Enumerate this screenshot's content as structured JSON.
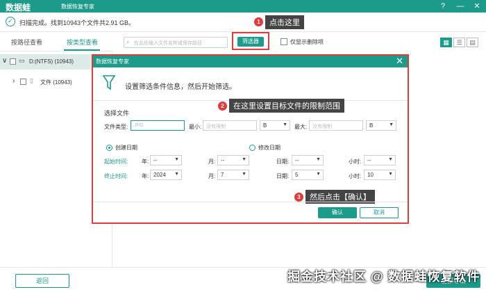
{
  "app": {
    "name": "数据蛙",
    "subtitle": "数据恢复专家",
    "controls": [
      "?",
      "—",
      "✕"
    ]
  },
  "status": {
    "text": "扫描完成。找到10943个文件共2.91 GB。"
  },
  "nav": {
    "tabs": [
      "按路径查看",
      "按类型查看"
    ],
    "active": 1
  },
  "toolbar": {
    "search_placeholder": "在此处输入文件名称或保存路径",
    "filter_label": "筛选器",
    "show_deleted_label": "仅显示删除项"
  },
  "tree": {
    "items": [
      {
        "label": "D:(NTFS) (10943)",
        "expand": "∨"
      },
      {
        "label": "文件 (10943)",
        "expand": "›"
      }
    ]
  },
  "dialog": {
    "title": "数据恢复专家",
    "close": "✕",
    "intro": "设置筛选条件信息，然后开始筛选。",
    "section": "选择文件",
    "file_type_label": "文件类型:",
    "file_type_placeholder": "JPG",
    "min_label": "最小:",
    "min_placeholder": "没有限制",
    "min_unit": "B",
    "max_label": "最大:",
    "max_placeholder": "没有限制",
    "max_unit": "B",
    "create_date_label": "创建日期",
    "modify_date_label": "修改日期",
    "start_label": "起始时间:",
    "end_label": "终止时间:",
    "year_label": "年:",
    "month_label": "月:",
    "day_label": "日期:",
    "hour_label": "小时:",
    "start": {
      "year": "--",
      "month": "--",
      "day": "--",
      "hour": "--"
    },
    "end": {
      "year": "2024",
      "month": "7",
      "day": "5",
      "hour": "10"
    },
    "confirm": "确认",
    "cancel": "取消"
  },
  "callouts": [
    {
      "num": "1",
      "text": "点击这里"
    },
    {
      "num": "2",
      "text": "在这里设置目标文件的限制范围"
    },
    {
      "num": "3",
      "text": "然后点击【确认】"
    }
  ],
  "bottom": {
    "back": "返回",
    "recover": "全部导出"
  },
  "watermark": "掘金技术社区 @ 数据蛙恢复软件",
  "colors": {
    "accent": "#1c9a8a",
    "highlight": "#e23b3b"
  }
}
